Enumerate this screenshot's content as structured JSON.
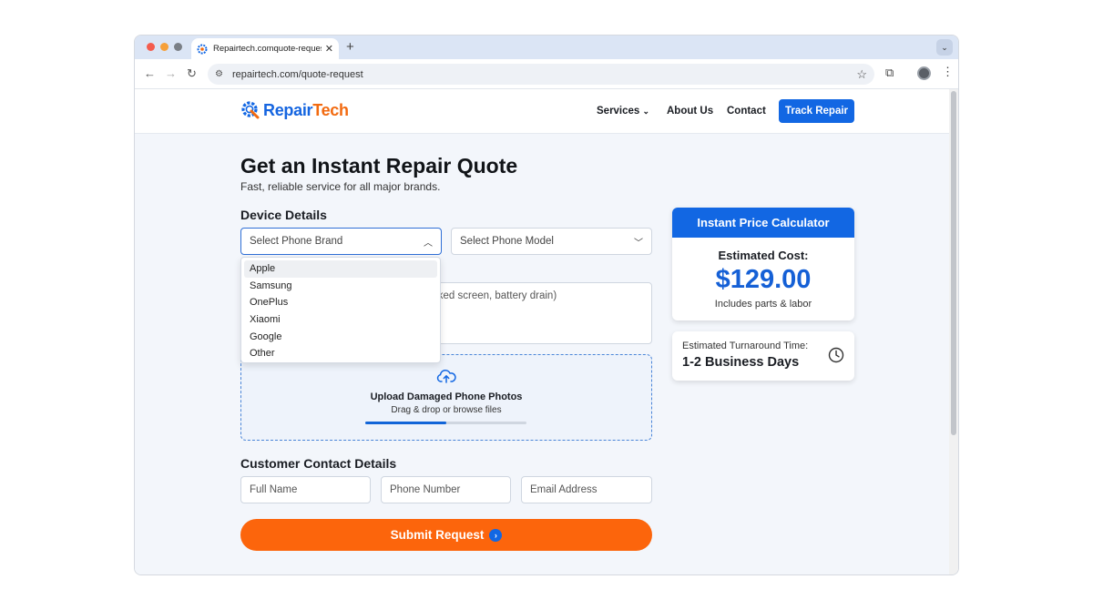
{
  "browser": {
    "tab_title": "Repairtech.comquote-request",
    "url": "repairtech.com/quote-request",
    "new_tab": "+",
    "tab_close": "✕"
  },
  "site": {
    "logo_part1": "Repair",
    "logo_part2": "Tech",
    "nav": {
      "services": "Services",
      "about": "About Us",
      "contact": "Contact",
      "track_repair": "Track Repair"
    }
  },
  "quote": {
    "title": "Get an Instant Repair Quote",
    "subtitle": "Fast, reliable service for all major brands.",
    "device_details_label": "Device Details",
    "brand_select": {
      "value": "Select Phone Brand"
    },
    "model_select": {
      "value": "Select Phone Model"
    },
    "brand_options": [
      "Apple",
      "Samsung",
      "OnePlus",
      "Xiaomi",
      "Google",
      "Other"
    ],
    "issue_placeholder_visible": "cked screen, battery drain)",
    "upload": {
      "title": "Upload Damaged Phone Photos",
      "subtitle": "Drag & drop or browse files",
      "progress": 0.5
    },
    "contact_label": "Customer Contact Details",
    "fields": {
      "full_name": "Full Name",
      "phone": "Phone Number",
      "email": "Email Address"
    },
    "submit_label": "Submit Request"
  },
  "calculator": {
    "header": "Instant Price Calculator",
    "estimated_label": "Estimated Cost:",
    "price": "$129.00",
    "note": "Includes parts & labor"
  },
  "turnaround": {
    "label": "Estimated Turnaround Time:",
    "value": "1-2 Business Days"
  },
  "colors": {
    "brand_blue": "#1267e3",
    "accent_orange": "#fc650c"
  }
}
